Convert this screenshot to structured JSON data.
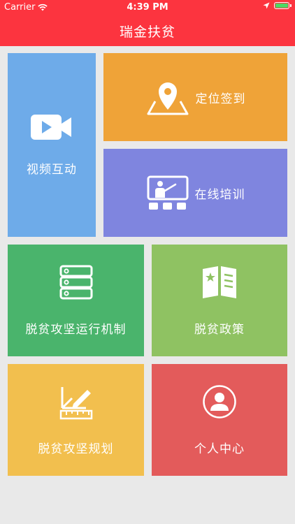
{
  "status_bar": {
    "carrier": "Carrier",
    "time": "4:39 PM"
  },
  "nav": {
    "title": "瑞金扶贫"
  },
  "tiles": {
    "video": {
      "label": "视频互动",
      "icon": "video-camera-icon",
      "color": "#6eabe9"
    },
    "location": {
      "label": "定位签到",
      "icon": "map-pin-icon",
      "color": "#efa338"
    },
    "training": {
      "label": "在线培训",
      "icon": "classroom-icon",
      "color": "#7f85df"
    },
    "mechanism": {
      "label": "脱贫攻坚运行机制",
      "icon": "server-stack-icon",
      "color": "#4ab46c"
    },
    "policy": {
      "label": "脱贫政策",
      "icon": "open-book-icon",
      "color": "#8fc262"
    },
    "plan": {
      "label": "脱贫攻坚规划",
      "icon": "ruler-pencil-icon",
      "color": "#f2bf4e"
    },
    "profile": {
      "label": "个人中心",
      "icon": "user-circle-icon",
      "color": "#e35b5b"
    }
  },
  "colors": {
    "header": "#fc343f",
    "background": "#e9e9e9"
  }
}
